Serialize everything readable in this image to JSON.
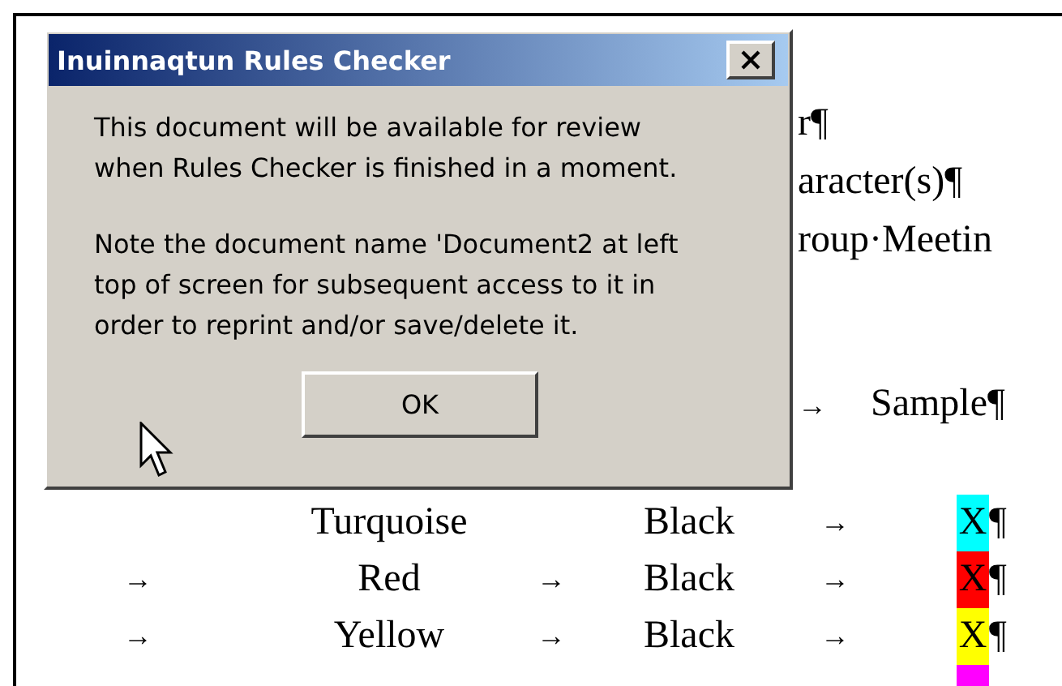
{
  "document": {
    "lines": [
      {
        "text": "r¶"
      },
      {
        "text": "aracter(s)¶"
      },
      {
        "text": "roup·Meetin"
      },
      {
        "tab": "→",
        "text": "Sample¶"
      }
    ],
    "rows": [
      {
        "name": "Turquoise",
        "fg": "Black",
        "tab3": "→",
        "swatch": {
          "text": "X",
          "color": "#00ffff"
        },
        "mark": "¶"
      },
      {
        "lead": "→",
        "name": "Red",
        "tab2": "→",
        "fg": "Black",
        "tab3": "→",
        "swatch": {
          "text": "X",
          "color": "#ff0000"
        },
        "mark": "¶"
      },
      {
        "lead": "→",
        "name": "Yellow",
        "tab2": "→",
        "fg": "Black",
        "tab3": "→",
        "swatch": {
          "text": "X",
          "color": "#ffff00"
        },
        "mark": "¶"
      },
      {
        "swatch": {
          "color": "#ff00ff"
        }
      }
    ]
  },
  "dialog": {
    "title": "Inuinnaqtun Rules Checker",
    "paragraphs": [
      {
        "lines": [
          "This document will be available for review",
          "when Rules Checker is finished in a moment."
        ]
      },
      {
        "lines": [
          "Note the document name 'Document2 at left",
          "top of screen for subsequent access to it in",
          "order to reprint and/or save/delete it."
        ]
      }
    ],
    "button": "OK"
  }
}
